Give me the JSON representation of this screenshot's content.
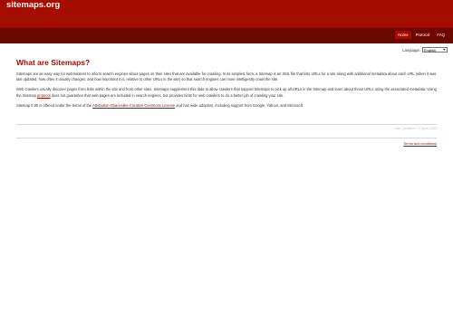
{
  "header": {
    "site_title": "sitemaps.org"
  },
  "nav": {
    "items": [
      "Home",
      "Protocol",
      "FAQ"
    ],
    "active": "Home"
  },
  "language": {
    "label": "Language:",
    "selected": "English"
  },
  "main": {
    "title": "What are Sitemaps?",
    "para1": "Sitemaps are an easy way for webmasters to inform search engines about pages on their sites that are available for crawling. In its simplest form, a Sitemap is an XML file that lists URLs for a site along with additional metadata about each URL (when it was last updated, how often it usually changes, and how important it is, relative to other URLs in the site) so that search engines can more intelligently crawl the site.",
    "para2_a": "Web crawlers usually discover pages from links within the site and from other sites. Sitemaps supplement this data to allow crawlers that support Sitemaps to pick up all URLs in the Sitemap and learn about those URLs using the associated metadata. Using the Sitemap ",
    "para2_link": "protocol",
    "para2_b": " does not guarantee that web pages are included in search engines, but provides hints for web crawlers to do a better job of crawling your site.",
    "para3_a": "Sitemap 0.90 is offered under the terms of the ",
    "para3_link": "Attribution-ShareAlike Creative Commons License",
    "para3_b": " and has wide adoption, including support from Google, Yahoo!, and Microsoft."
  },
  "footer": {
    "last_updated": "Last Updated: 17 April 2020",
    "terms_link": "Terms and conditions"
  }
}
